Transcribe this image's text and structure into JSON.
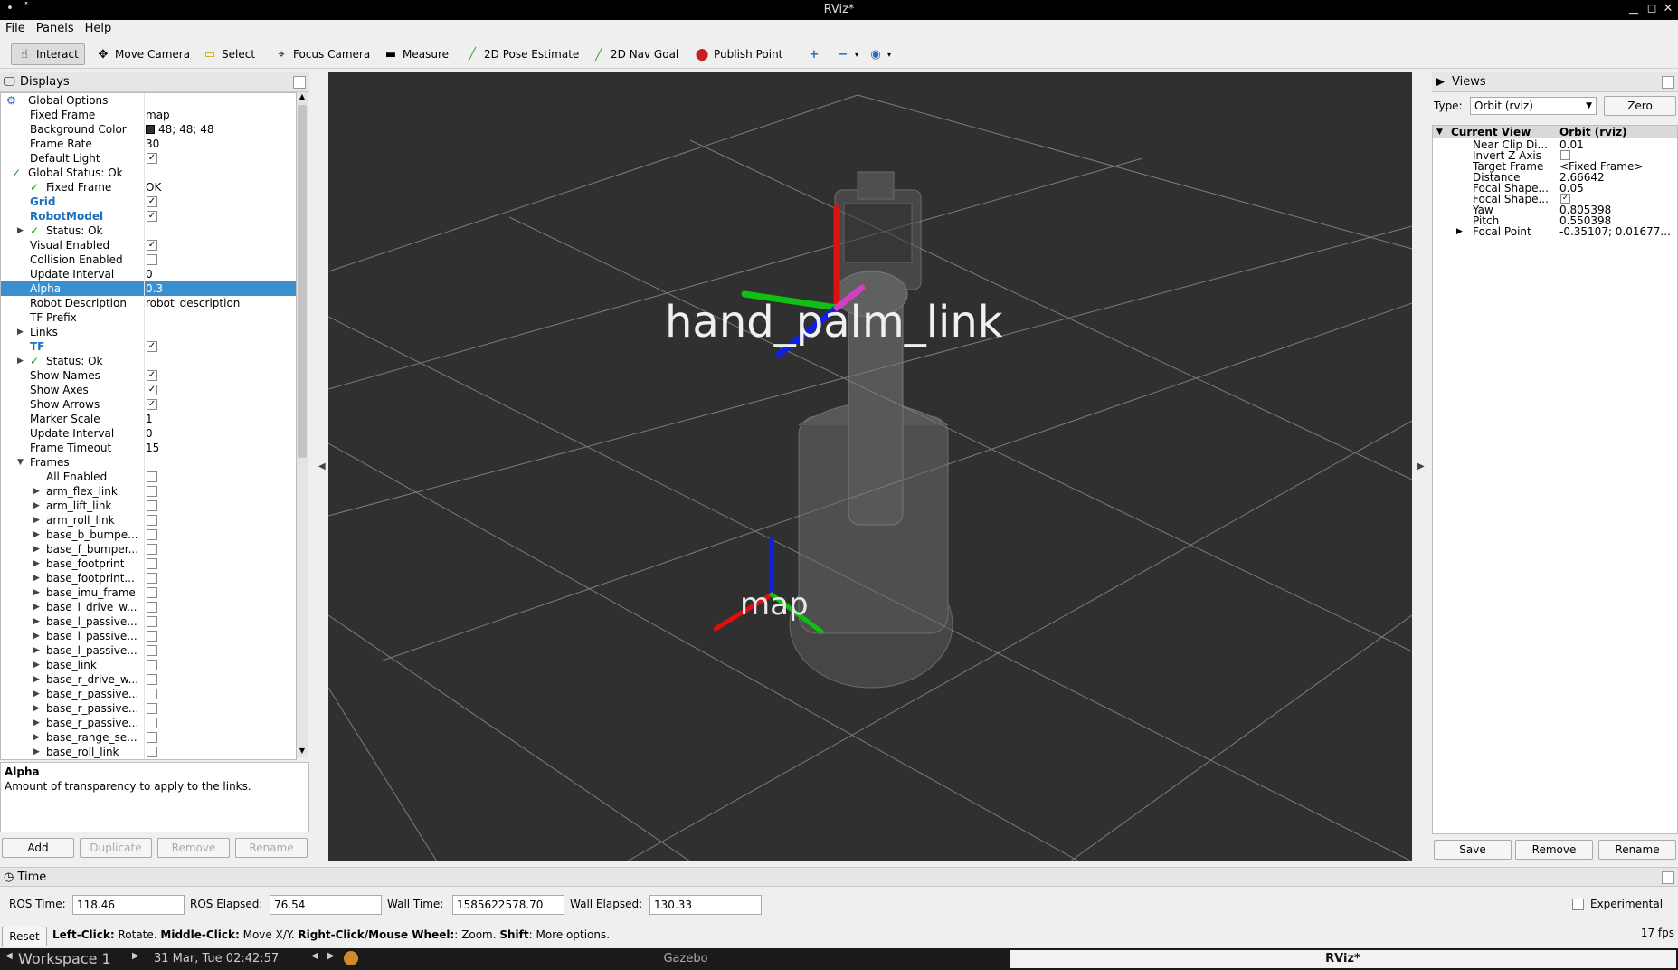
{
  "window": {
    "title": "RViz*"
  },
  "menu": [
    "File",
    "Panels",
    "Help"
  ],
  "toolbar": {
    "tools": [
      {
        "label": "Interact",
        "icon": "cursor-icon",
        "active": true
      },
      {
        "label": "Move Camera",
        "icon": "move-camera-icon"
      },
      {
        "label": "Select",
        "icon": "select-icon"
      },
      {
        "label": "Focus Camera",
        "icon": "focus-camera-icon"
      },
      {
        "label": "Measure",
        "icon": "measure-icon"
      },
      {
        "label": "2D Pose Estimate",
        "icon": "pose-estimate-icon"
      },
      {
        "label": "2D Nav Goal",
        "icon": "nav-goal-icon"
      },
      {
        "label": "Publish Point",
        "icon": "publish-point-icon"
      }
    ]
  },
  "displays": {
    "title": "Displays",
    "rows": [
      {
        "name": "Global Options",
        "value": ""
      },
      {
        "name": "Fixed Frame",
        "value": "map"
      },
      {
        "name": "Background Color",
        "value": "48; 48; 48"
      },
      {
        "name": "Frame Rate",
        "value": "30"
      },
      {
        "name": "Default Light",
        "value": "✓"
      },
      {
        "name": "Global Status: Ok",
        "value": ""
      },
      {
        "name": "Fixed Frame",
        "value": "OK"
      },
      {
        "name": "Grid",
        "value": "✓"
      },
      {
        "name": "RobotModel",
        "value": "✓"
      },
      {
        "name": "Status: Ok",
        "value": ""
      },
      {
        "name": "Visual Enabled",
        "value": "✓"
      },
      {
        "name": "Collision Enabled",
        "value": ""
      },
      {
        "name": "Update Interval",
        "value": "0"
      },
      {
        "name": "Alpha",
        "value": "0.3"
      },
      {
        "name": "Robot Description",
        "value": "robot_description"
      },
      {
        "name": "TF Prefix",
        "value": ""
      },
      {
        "name": "Links",
        "value": ""
      },
      {
        "name": "TF",
        "value": "✓"
      },
      {
        "name": "Status: Ok",
        "value": ""
      },
      {
        "name": "Show Names",
        "value": "✓"
      },
      {
        "name": "Show Axes",
        "value": "✓"
      },
      {
        "name": "Show Arrows",
        "value": "✓"
      },
      {
        "name": "Marker Scale",
        "value": "1"
      },
      {
        "name": "Update Interval",
        "value": "0"
      },
      {
        "name": "Frame Timeout",
        "value": "15"
      },
      {
        "name": "Frames",
        "value": ""
      },
      {
        "name": "All Enabled",
        "value": ""
      },
      {
        "name": "arm_flex_link",
        "value": ""
      },
      {
        "name": "arm_lift_link",
        "value": ""
      },
      {
        "name": "arm_roll_link",
        "value": ""
      },
      {
        "name": "base_b_bumpe...",
        "value": ""
      },
      {
        "name": "base_f_bumper...",
        "value": ""
      },
      {
        "name": "base_footprint",
        "value": ""
      },
      {
        "name": "base_footprint...",
        "value": ""
      },
      {
        "name": "base_imu_frame",
        "value": ""
      },
      {
        "name": "base_l_drive_w...",
        "value": ""
      },
      {
        "name": "base_l_passive...",
        "value": ""
      },
      {
        "name": "base_l_passive...",
        "value": ""
      },
      {
        "name": "base_l_passive...",
        "value": ""
      },
      {
        "name": "base_link",
        "value": ""
      },
      {
        "name": "base_r_drive_w...",
        "value": ""
      },
      {
        "name": "base_r_passive...",
        "value": ""
      },
      {
        "name": "base_r_passive...",
        "value": ""
      },
      {
        "name": "base_r_passive...",
        "value": ""
      },
      {
        "name": "base_range_se...",
        "value": ""
      },
      {
        "name": "base_roll_link",
        "value": ""
      }
    ],
    "desc_title": "Alpha",
    "desc_text": "Amount of transparency to apply to the links.",
    "buttons": [
      "Add",
      "Duplicate",
      "Remove",
      "Rename"
    ]
  },
  "viewport": {
    "labels": [
      "hand_palm_link",
      "map"
    ],
    "bg": "#303030"
  },
  "views": {
    "title": "Views",
    "type_label": "Type:",
    "type_value": "Orbit (rviz)",
    "zero": "Zero",
    "header_name": "Current View",
    "header_value": "Orbit (rviz)",
    "rows": [
      {
        "name": "Near Clip Di...",
        "value": "0.01"
      },
      {
        "name": "Invert Z Axis",
        "value": ""
      },
      {
        "name": "Target Frame",
        "value": "<Fixed Frame>"
      },
      {
        "name": "Distance",
        "value": "2.66642"
      },
      {
        "name": "Focal Shape...",
        "value": "0.05"
      },
      {
        "name": "Focal Shape...",
        "value": "✓"
      },
      {
        "name": "Yaw",
        "value": "0.805398"
      },
      {
        "name": "Pitch",
        "value": "0.550398"
      },
      {
        "name": "Focal Point",
        "value": "-0.35107; 0.01677..."
      }
    ],
    "buttons": [
      "Save",
      "Remove",
      "Rename"
    ]
  },
  "time": {
    "title": "Time",
    "ros_time_label": "ROS Time:",
    "ros_time": "118.46",
    "ros_elapsed_label": "ROS Elapsed:",
    "ros_elapsed": "76.54",
    "wall_time_label": "Wall Time:",
    "wall_time": "1585622578.70",
    "wall_elapsed_label": "Wall Elapsed:",
    "wall_elapsed": "130.33",
    "experimental": "Experimental"
  },
  "status": {
    "reset": "Reset",
    "hint_bold1": "Left-Click:",
    "hint1": " Rotate. ",
    "hint_bold2": "Middle-Click:",
    "hint2": " Move X/Y. ",
    "hint_bold3": "Right-Click/Mouse Wheel:",
    "hint3": ": Zoom. ",
    "hint_bold4": "Shift",
    "hint4": ": More options.",
    "fps": "17 fps"
  },
  "taskbar": {
    "workspace": "Workspace 1",
    "datetime": "31 Mar, Tue 02:42:57",
    "app1": "Gazebo",
    "app2": "RViz*"
  }
}
